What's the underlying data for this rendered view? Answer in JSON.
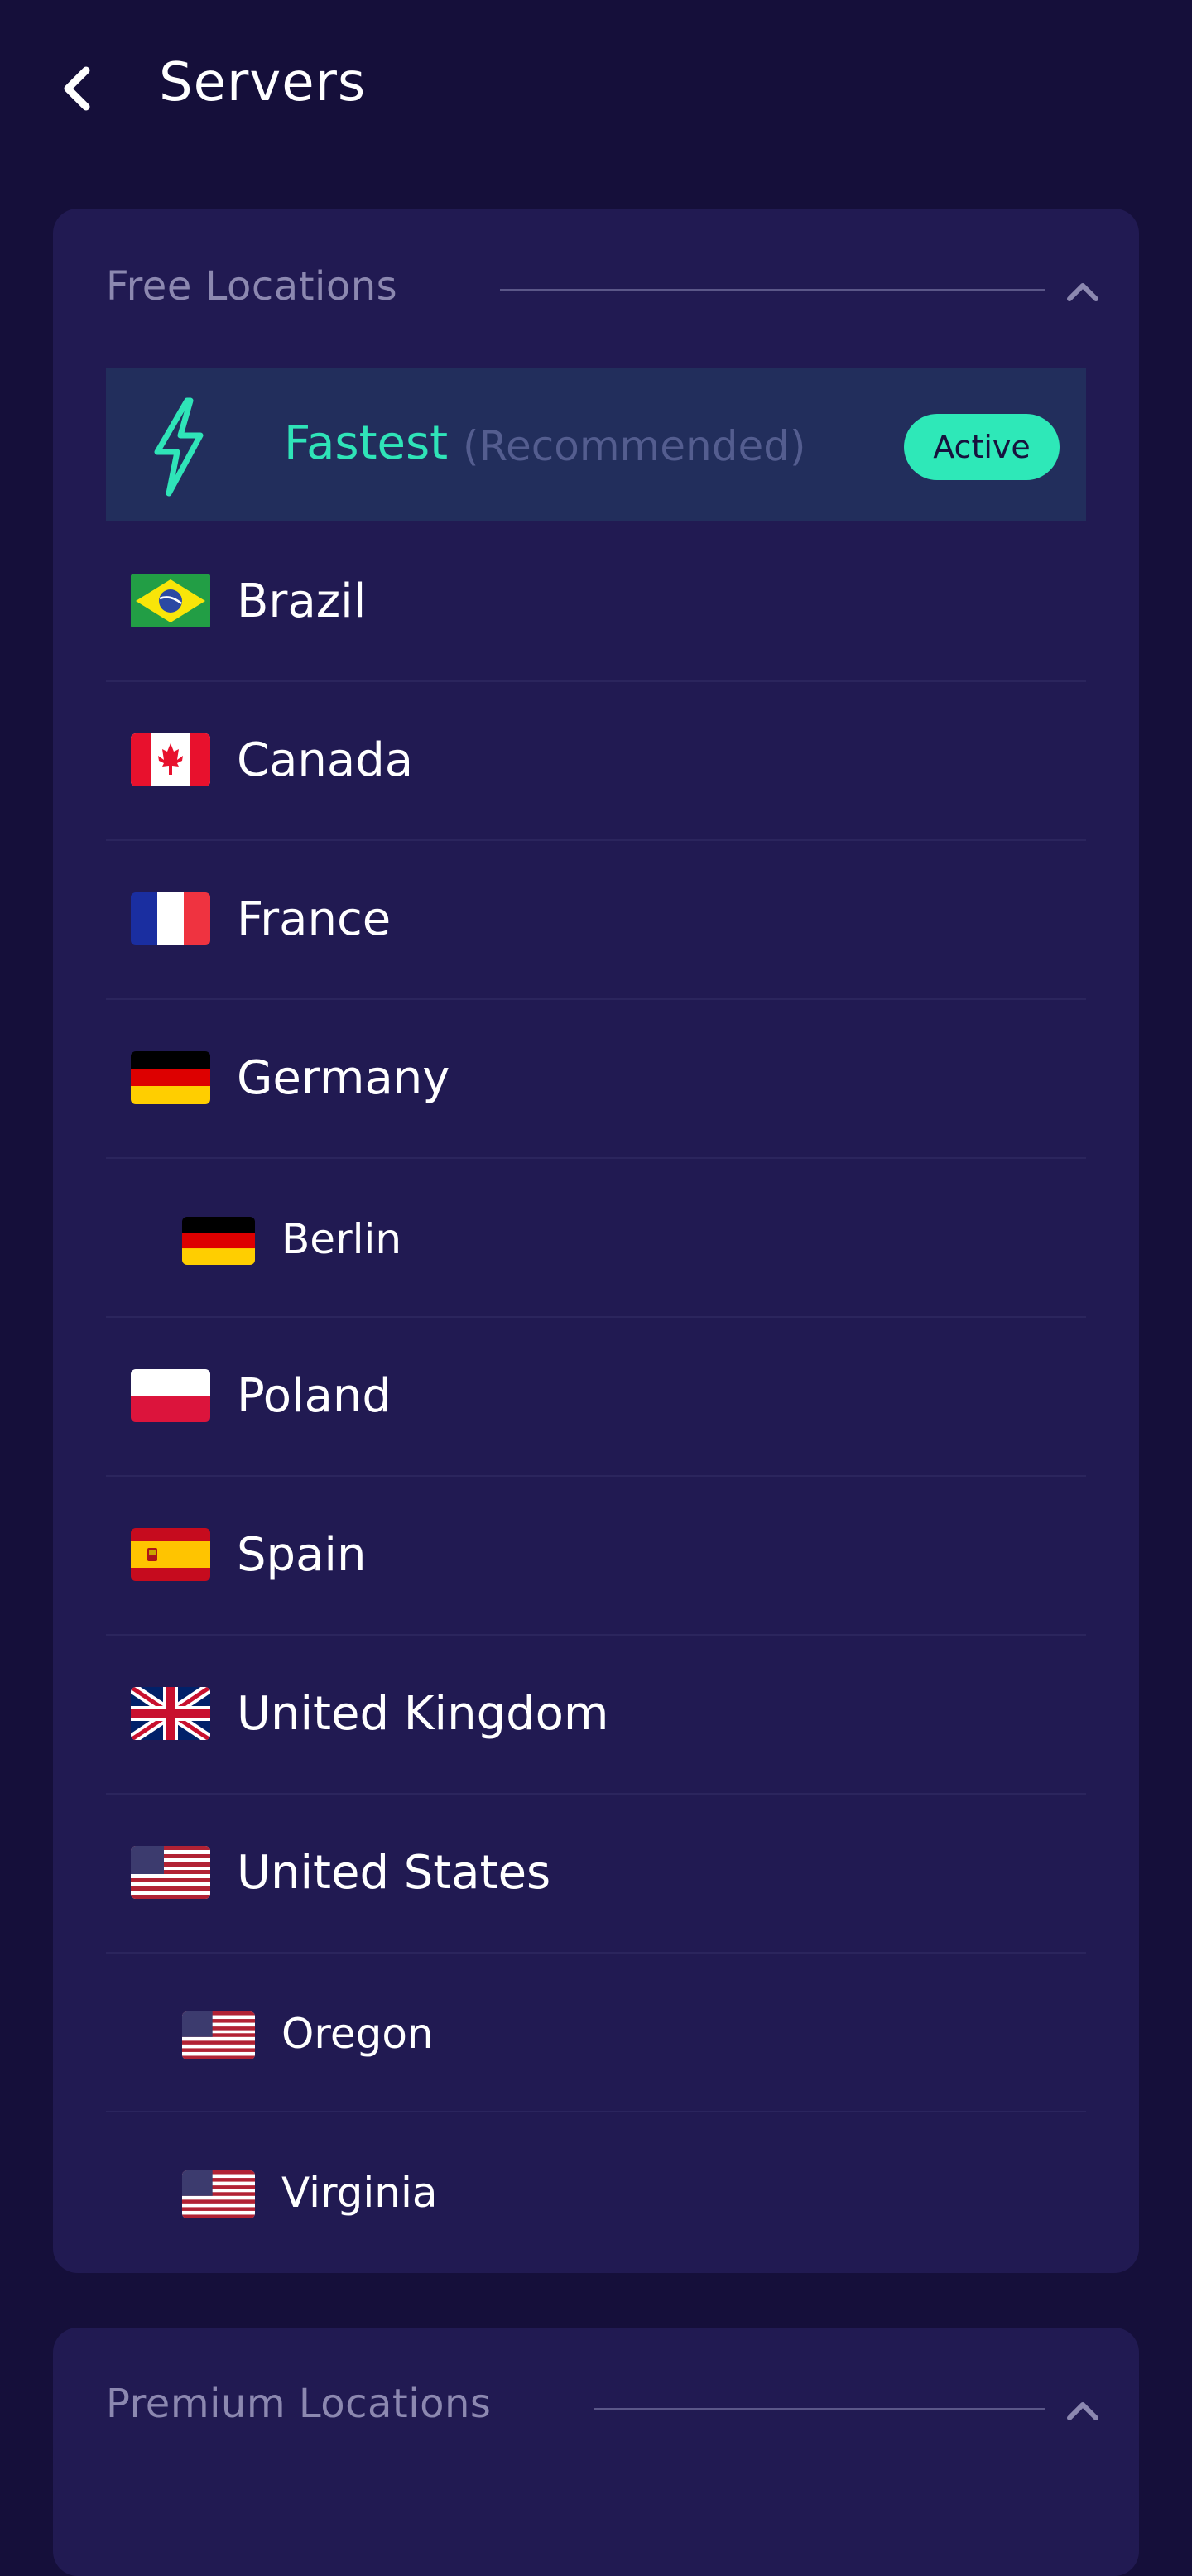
{
  "header": {
    "title": "Servers",
    "back_icon": "chevron-left-icon"
  },
  "free_section": {
    "title": "Free Locations",
    "collapse_icon": "chevron-up-icon",
    "fastest": {
      "icon": "lightning-bolt-icon",
      "label": "Fastest",
      "note": "(Recommended)",
      "status": "Active"
    },
    "locations": [
      {
        "label": "Brazil",
        "flag": "brazil-flag-icon",
        "level": 0
      },
      {
        "label": "Canada",
        "flag": "canada-flag-icon",
        "level": 0
      },
      {
        "label": "France",
        "flag": "france-flag-icon",
        "level": 0
      },
      {
        "label": "Germany",
        "flag": "germany-flag-icon",
        "level": 0
      },
      {
        "label": "Berlin",
        "flag": "germany-flag-icon",
        "level": 1
      },
      {
        "label": "Poland",
        "flag": "poland-flag-icon",
        "level": 0
      },
      {
        "label": "Spain",
        "flag": "spain-flag-icon",
        "level": 0
      },
      {
        "label": "United Kingdom",
        "flag": "uk-flag-icon",
        "level": 0
      },
      {
        "label": "United States",
        "flag": "usa-flag-icon",
        "level": 0
      },
      {
        "label": "Oregon",
        "flag": "usa-flag-icon",
        "level": 1
      },
      {
        "label": "Virginia",
        "flag": "usa-flag-icon",
        "level": 1
      }
    ]
  },
  "premium_section": {
    "title": "Premium Locations",
    "collapse_icon": "chevron-up-icon"
  },
  "colors": {
    "background": "#150f3a",
    "card": "#211a52",
    "accent": "#2ee8b8",
    "highlight_row": "#222e5c"
  }
}
